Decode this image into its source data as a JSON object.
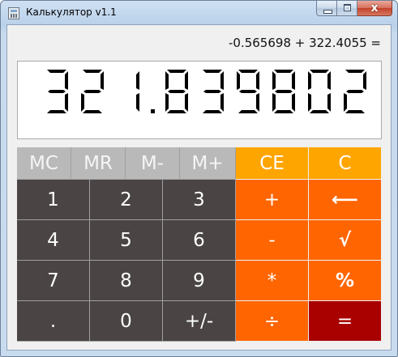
{
  "window": {
    "title": "Калькулятор v1.1",
    "icon": "calculator-icon",
    "controls": {
      "minimize": "minimize-icon",
      "maximize": "maximize-icon",
      "close": "close-icon",
      "close_glyph": "x"
    }
  },
  "calculator": {
    "expression": "-0.565698 + 322.4055  =",
    "display": "321.839802",
    "colors": {
      "memory": "#b9b9b9",
      "digit": "#4a4444",
      "clear": "#ffa500",
      "operator": "#ff6500",
      "equals": "#a90000"
    },
    "keys": {
      "mc": "MC",
      "mr": "MR",
      "m_minus": "M-",
      "m_plus": "M+",
      "ce": "CE",
      "c": "C",
      "d1": "1",
      "d2": "2",
      "d3": "3",
      "plus": "+",
      "backspace": "⟵",
      "d4": "4",
      "d5": "5",
      "d6": "6",
      "minus": "-",
      "sqrt": "√",
      "d7": "7",
      "d8": "8",
      "d9": "9",
      "multiply": "*",
      "percent": "%",
      "dot": ".",
      "d0": "0",
      "negate": "+/-",
      "divide": "÷",
      "equals": "="
    }
  }
}
